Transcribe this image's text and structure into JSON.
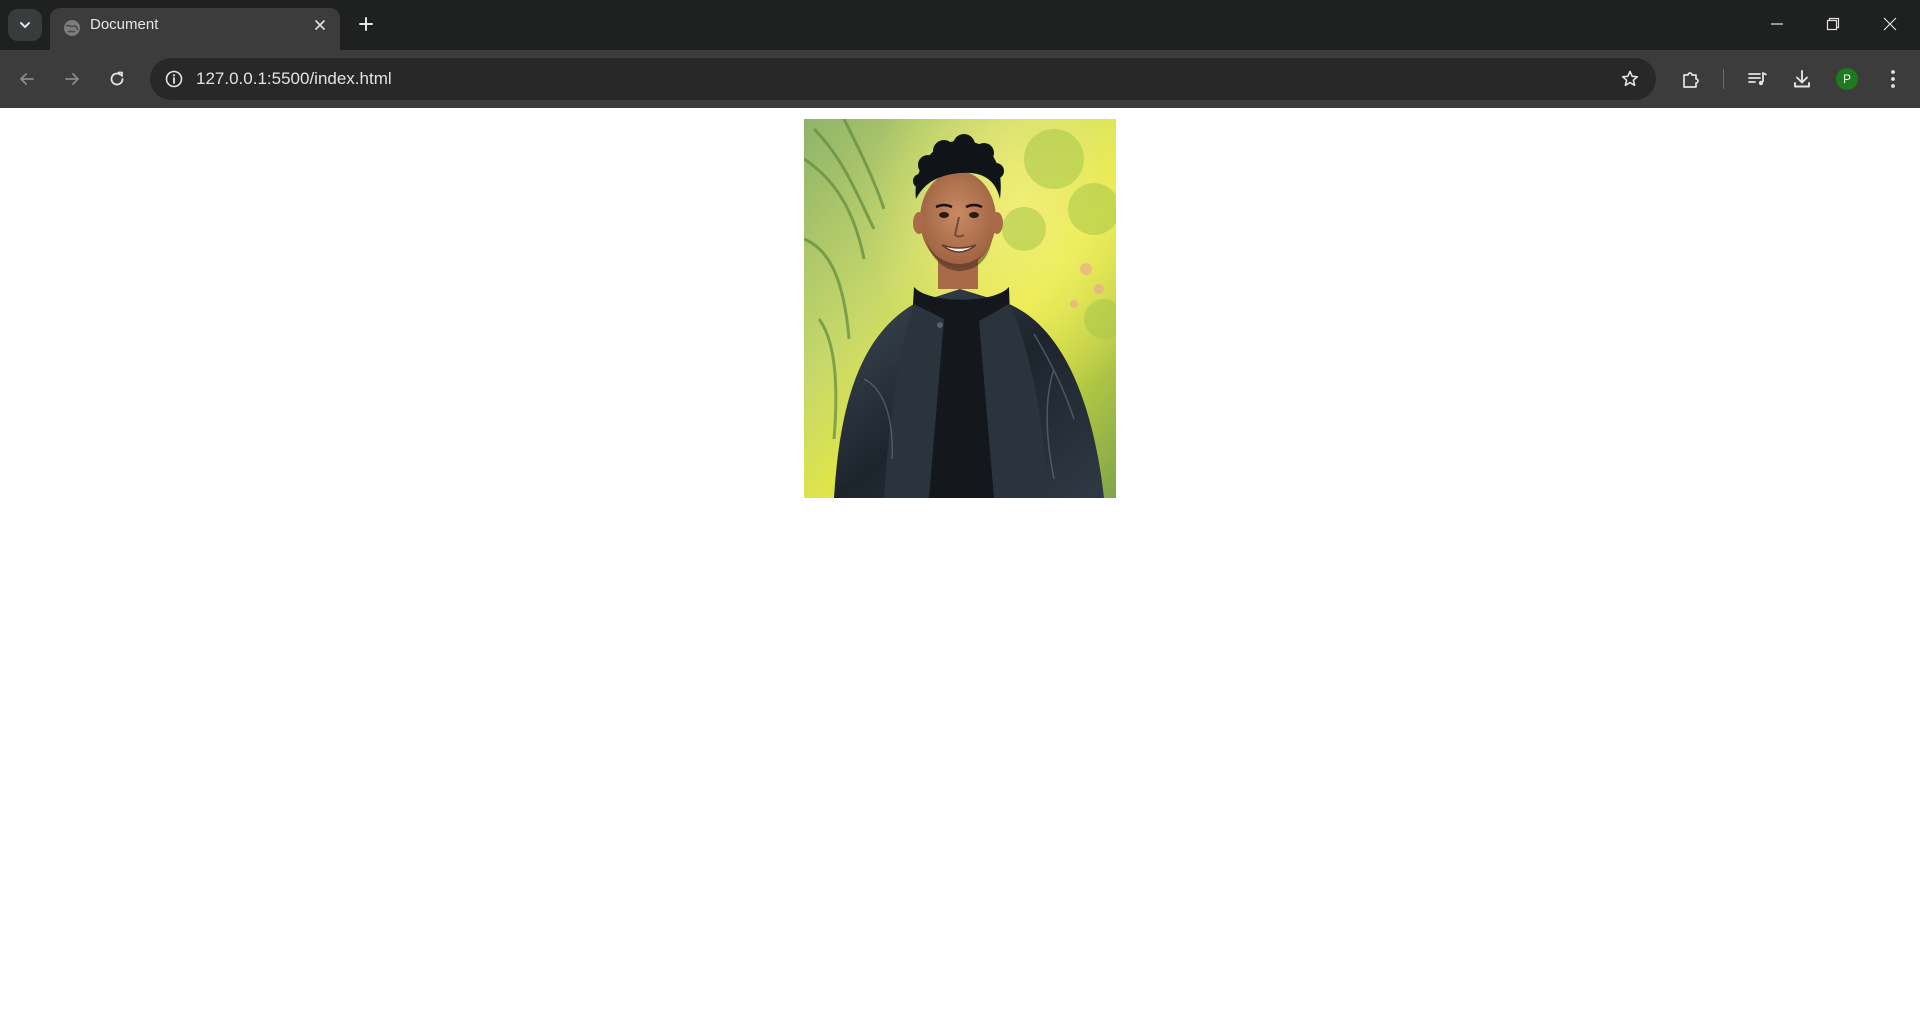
{
  "tab": {
    "title": "Document"
  },
  "address_bar": {
    "url": "127.0.0.1:5500/index.html"
  },
  "profile": {
    "initial": "P",
    "color": "#1e7a1e"
  },
  "page": {
    "image_alt": "Portrait photo"
  },
  "icons": {
    "tab_list": "chevron-down-icon",
    "favicon": "globe-icon",
    "tab_close": "close-icon",
    "new_tab": "plus-icon",
    "minimize": "minimize-icon",
    "restore": "restore-icon",
    "close_window": "close-icon",
    "back": "arrow-left-icon",
    "forward": "arrow-right-icon",
    "reload": "reload-icon",
    "site_info": "info-icon",
    "bookmark": "star-icon",
    "extensions": "puzzle-icon",
    "media": "playlist-icon",
    "downloads": "download-icon",
    "menu": "kebab-menu-icon"
  }
}
